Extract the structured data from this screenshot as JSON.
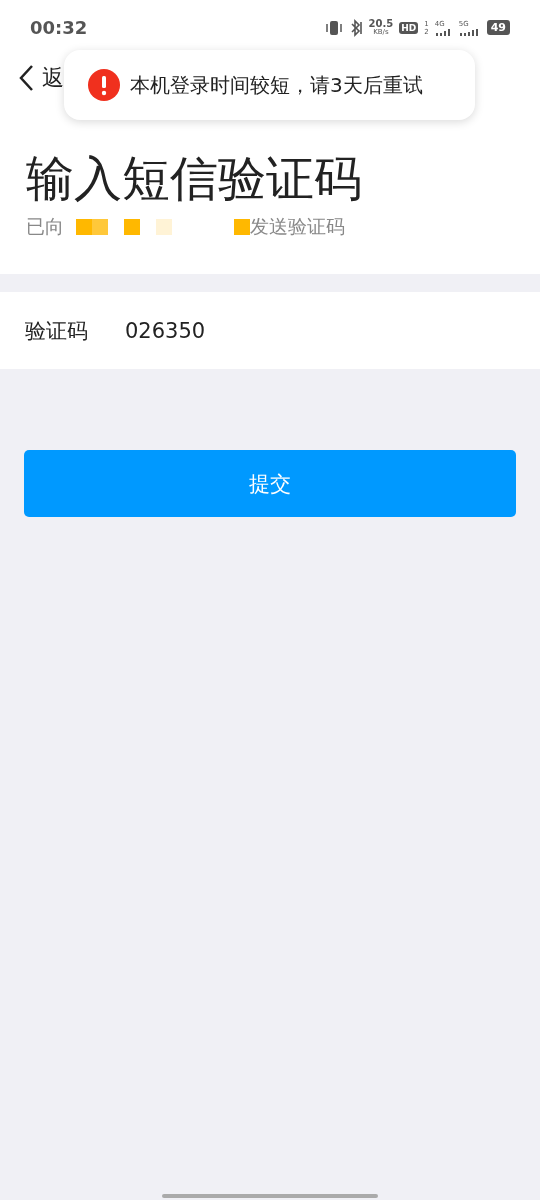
{
  "status_bar": {
    "time": "00:32",
    "speed": "20.5",
    "speed_unit": "KB/s",
    "hd": "HD",
    "sim_1": "1",
    "sim_2": "2",
    "net_1": "4G",
    "net_2": "5G",
    "battery": "49"
  },
  "nav": {
    "back_label": "返"
  },
  "toast": {
    "message": "本机登录时间较短，请3天后重试"
  },
  "title": "输入短信验证码",
  "subtitle": {
    "prefix": "已向",
    "suffix": "发送验证码"
  },
  "field": {
    "label": "验证码",
    "value": "026350"
  },
  "submit_button": "提交"
}
